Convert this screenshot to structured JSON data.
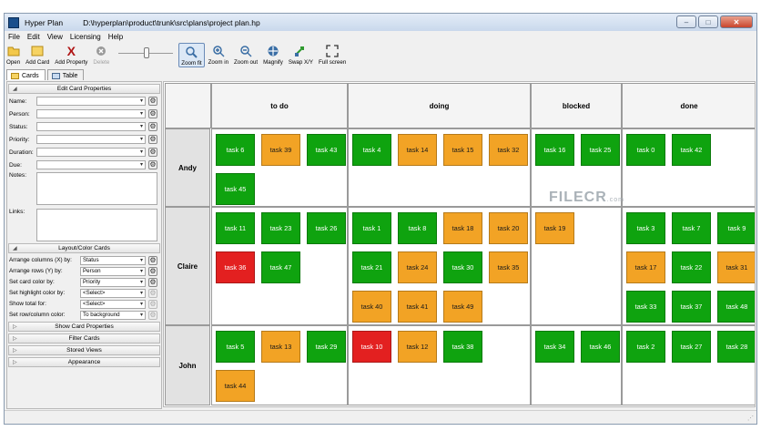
{
  "window": {
    "app_title": "Hyper Plan",
    "file_path": "D:\\hyperplan\\product\\trunk\\src\\plans\\project plan.hp",
    "btn_minimize": "–",
    "btn_maximize": "□",
    "btn_close": "✕"
  },
  "menu": [
    "File",
    "Edit",
    "View",
    "Licensing",
    "Help"
  ],
  "toolbar": {
    "open": "Open",
    "add_card": "Add Card",
    "add_property": "Add Property",
    "delete": "Delete",
    "zoom_fit": "Zoom fit",
    "zoom_in": "Zoom in",
    "zoom_out": "Zoom out",
    "magnify": "Magnify",
    "swap": "Swap X/Y",
    "full_screen": "Full screen"
  },
  "tabs": [
    "Cards",
    "Table"
  ],
  "edit_panel": {
    "title": "Edit Card Properties",
    "fields": [
      "Name:",
      "Person:",
      "Status:",
      "Priority:",
      "Duration:",
      "Due:"
    ],
    "notes": "Notes:",
    "links": "Links:"
  },
  "layout_panel": {
    "title": "Layout/Color Cards",
    "rows": [
      {
        "label": "Arrange columns (X) by:",
        "value": "Status"
      },
      {
        "label": "Arrange rows (Y) by:",
        "value": "Person"
      },
      {
        "label": "Set card color by:",
        "value": "Priority"
      },
      {
        "label": "Set highlight color by:",
        "value": "<Select>"
      },
      {
        "label": "Show total for:",
        "value": "<Select>"
      },
      {
        "label": "Set row/column color:",
        "value": "To background"
      }
    ]
  },
  "collapsed_sections": [
    "Show Card Properties",
    "Filter Cards",
    "Stored Views",
    "Appearance"
  ],
  "board": {
    "columns": [
      "to do",
      "doing",
      "blocked",
      "done"
    ],
    "rows": [
      "Andy",
      "Claire",
      "John"
    ],
    "colors": {
      "green": "#0fa30f",
      "orange": "#f2a325",
      "red": "#e32020"
    },
    "cards": {
      "Andy": {
        "to do": [
          {
            "label": "task 6",
            "color": "green"
          },
          {
            "label": "task 39",
            "color": "orange"
          },
          {
            "label": "task 43",
            "color": "green"
          },
          {
            "label": "task 45",
            "color": "green"
          }
        ],
        "doing": [
          {
            "label": "task 4",
            "color": "green"
          },
          {
            "label": "task 14",
            "color": "orange"
          },
          {
            "label": "task 15",
            "color": "orange"
          },
          {
            "label": "task 32",
            "color": "orange"
          }
        ],
        "blocked": [
          {
            "label": "task 16",
            "color": "green"
          },
          {
            "label": "task 25",
            "color": "green"
          }
        ],
        "done": [
          {
            "label": "task 0",
            "color": "green"
          },
          {
            "label": "task 42",
            "color": "green"
          }
        ]
      },
      "Claire": {
        "to do": [
          {
            "label": "task 11",
            "color": "green"
          },
          {
            "label": "task 23",
            "color": "green"
          },
          {
            "label": "task 26",
            "color": "green"
          },
          {
            "label": "task 36",
            "color": "red"
          },
          {
            "label": "task 47",
            "color": "green"
          }
        ],
        "doing": [
          {
            "label": "task 1",
            "color": "green"
          },
          {
            "label": "task 8",
            "color": "green"
          },
          {
            "label": "task 18",
            "color": "orange"
          },
          {
            "label": "task 20",
            "color": "orange"
          },
          {
            "label": "task 21",
            "color": "green"
          },
          {
            "label": "task 24",
            "color": "orange"
          },
          {
            "label": "task 30",
            "color": "green"
          },
          {
            "label": "task 35",
            "color": "orange"
          },
          {
            "label": "task 40",
            "color": "orange"
          },
          {
            "label": "task 41",
            "color": "orange"
          },
          {
            "label": "task 49",
            "color": "orange"
          }
        ],
        "blocked": [
          {
            "label": "task 19",
            "color": "orange"
          }
        ],
        "done": [
          {
            "label": "task 3",
            "color": "green"
          },
          {
            "label": "task 7",
            "color": "green"
          },
          {
            "label": "task 9",
            "color": "green"
          },
          {
            "label": "task 17",
            "color": "orange"
          },
          {
            "label": "task 22",
            "color": "green"
          },
          {
            "label": "task 31",
            "color": "orange"
          },
          {
            "label": "task 33",
            "color": "green"
          },
          {
            "label": "task 37",
            "color": "green"
          },
          {
            "label": "task 48",
            "color": "green"
          }
        ]
      },
      "John": {
        "to do": [
          {
            "label": "task 5",
            "color": "green"
          },
          {
            "label": "task 13",
            "color": "orange"
          },
          {
            "label": "task 29",
            "color": "green"
          },
          {
            "label": "task 44",
            "color": "orange"
          }
        ],
        "doing": [
          {
            "label": "task 10",
            "color": "red"
          },
          {
            "label": "task 12",
            "color": "orange"
          },
          {
            "label": "task 38",
            "color": "green"
          }
        ],
        "blocked": [
          {
            "label": "task 34",
            "color": "green"
          },
          {
            "label": "task 46",
            "color": "green"
          }
        ],
        "done": [
          {
            "label": "task 2",
            "color": "green"
          },
          {
            "label": "task 27",
            "color": "green"
          },
          {
            "label": "task 28",
            "color": "green"
          }
        ]
      }
    }
  },
  "watermark": {
    "text": "FILECR",
    "suffix": ".com"
  }
}
